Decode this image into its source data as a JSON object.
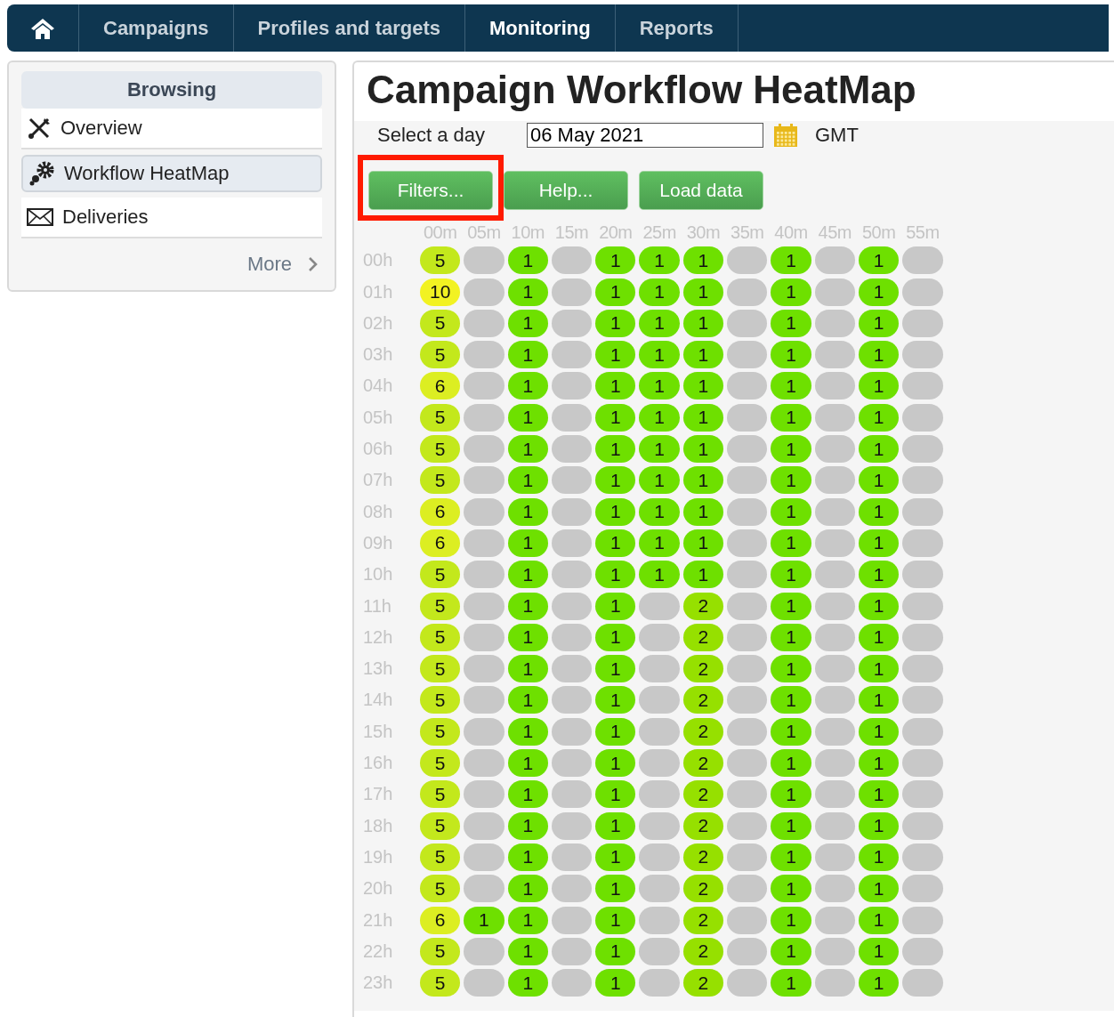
{
  "nav": {
    "tabs": [
      {
        "label": "Campaigns",
        "selected": false
      },
      {
        "label": "Profiles and targets",
        "selected": false
      },
      {
        "label": "Monitoring",
        "selected": true
      },
      {
        "label": "Reports",
        "selected": false
      }
    ]
  },
  "sidebar": {
    "heading": "Browsing",
    "items": [
      {
        "label": "Overview",
        "kind": "tools",
        "selected": false
      },
      {
        "label": "Workflow HeatMap",
        "kind": "gears",
        "selected": true
      },
      {
        "label": "Deliveries",
        "kind": "envelope",
        "selected": false
      }
    ],
    "more": "More"
  },
  "page": {
    "title": "Campaign Workflow HeatMap",
    "day_label": "Select a day",
    "day": "06 May 2021",
    "timezone": "GMT"
  },
  "buttons": [
    {
      "label": "Filters...",
      "highlighted": true
    },
    {
      "label": "Help...",
      "highlighted": false
    },
    {
      "label": "Load data",
      "highlighted": false
    }
  ],
  "heatmap": {
    "columns": [
      "00m",
      "05m",
      "10m",
      "15m",
      "20m",
      "25m",
      "30m",
      "35m",
      "40m",
      "45m",
      "50m",
      "55m"
    ],
    "rows": [
      {
        "label": "00h",
        "cells": [
          "5",
          null,
          "1",
          null,
          "1",
          "1",
          "1",
          null,
          "1",
          null,
          "1",
          null
        ]
      },
      {
        "label": "01h",
        "cells": [
          "10",
          null,
          "1",
          null,
          "1",
          "1",
          "1",
          null,
          "1",
          null,
          "1",
          null
        ]
      },
      {
        "label": "02h",
        "cells": [
          "5",
          null,
          "1",
          null,
          "1",
          "1",
          "1",
          null,
          "1",
          null,
          "1",
          null
        ]
      },
      {
        "label": "03h",
        "cells": [
          "5",
          null,
          "1",
          null,
          "1",
          "1",
          "1",
          null,
          "1",
          null,
          "1",
          null
        ]
      },
      {
        "label": "04h",
        "cells": [
          "6",
          null,
          "1",
          null,
          "1",
          "1",
          "1",
          null,
          "1",
          null,
          "1",
          null
        ]
      },
      {
        "label": "05h",
        "cells": [
          "5",
          null,
          "1",
          null,
          "1",
          "1",
          "1",
          null,
          "1",
          null,
          "1",
          null
        ]
      },
      {
        "label": "06h",
        "cells": [
          "5",
          null,
          "1",
          null,
          "1",
          "1",
          "1",
          null,
          "1",
          null,
          "1",
          null
        ]
      },
      {
        "label": "07h",
        "cells": [
          "5",
          null,
          "1",
          null,
          "1",
          "1",
          "1",
          null,
          "1",
          null,
          "1",
          null
        ]
      },
      {
        "label": "08h",
        "cells": [
          "6",
          null,
          "1",
          null,
          "1",
          "1",
          "1",
          null,
          "1",
          null,
          "1",
          null
        ]
      },
      {
        "label": "09h",
        "cells": [
          "6",
          null,
          "1",
          null,
          "1",
          "1",
          "1",
          null,
          "1",
          null,
          "1",
          null
        ]
      },
      {
        "label": "10h",
        "cells": [
          "5",
          null,
          "1",
          null,
          "1",
          "1",
          "1",
          null,
          "1",
          null,
          "1",
          null
        ]
      },
      {
        "label": "11h",
        "cells": [
          "5",
          null,
          "1",
          null,
          "1",
          null,
          "2",
          null,
          "1",
          null,
          "1",
          null
        ]
      },
      {
        "label": "12h",
        "cells": [
          "5",
          null,
          "1",
          null,
          "1",
          null,
          "2",
          null,
          "1",
          null,
          "1",
          null
        ]
      },
      {
        "label": "13h",
        "cells": [
          "5",
          null,
          "1",
          null,
          "1",
          null,
          "2",
          null,
          "1",
          null,
          "1",
          null
        ]
      },
      {
        "label": "14h",
        "cells": [
          "5",
          null,
          "1",
          null,
          "1",
          null,
          "2",
          null,
          "1",
          null,
          "1",
          null
        ]
      },
      {
        "label": "15h",
        "cells": [
          "5",
          null,
          "1",
          null,
          "1",
          null,
          "2",
          null,
          "1",
          null,
          "1",
          null
        ]
      },
      {
        "label": "16h",
        "cells": [
          "5",
          null,
          "1",
          null,
          "1",
          null,
          "2",
          null,
          "1",
          null,
          "1",
          null
        ]
      },
      {
        "label": "17h",
        "cells": [
          "5",
          null,
          "1",
          null,
          "1",
          null,
          "2",
          null,
          "1",
          null,
          "1",
          null
        ]
      },
      {
        "label": "18h",
        "cells": [
          "5",
          null,
          "1",
          null,
          "1",
          null,
          "2",
          null,
          "1",
          null,
          "1",
          null
        ]
      },
      {
        "label": "19h",
        "cells": [
          "5",
          null,
          "1",
          null,
          "1",
          null,
          "2",
          null,
          "1",
          null,
          "1",
          null
        ]
      },
      {
        "label": "20h",
        "cells": [
          "5",
          null,
          "1",
          null,
          "1",
          null,
          "2",
          null,
          "1",
          null,
          "1",
          null
        ]
      },
      {
        "label": "21h",
        "cells": [
          "6",
          "1",
          "1",
          null,
          "1",
          null,
          "2",
          null,
          "1",
          null,
          "1",
          null
        ]
      },
      {
        "label": "22h",
        "cells": [
          "5",
          null,
          "1",
          null,
          "1",
          null,
          "2",
          null,
          "1",
          null,
          "1",
          null
        ]
      },
      {
        "label": "23h",
        "cells": [
          "5",
          null,
          "1",
          null,
          "1",
          null,
          "2",
          null,
          "1",
          null,
          "1",
          null
        ]
      }
    ]
  }
}
